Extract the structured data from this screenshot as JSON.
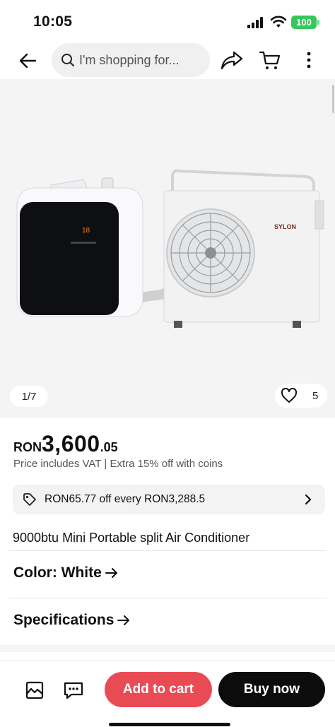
{
  "status": {
    "time": "10:05",
    "battery": "100"
  },
  "nav": {
    "search_placeholder": "I'm shopping for..."
  },
  "gallery": {
    "page": "1/7",
    "likes": "5",
    "brand_label": "SYLON"
  },
  "price": {
    "currency": "RON",
    "main": "3,600",
    "cents": ".05",
    "note": "Price includes VAT | Extra 15% off with coins"
  },
  "coupon": {
    "text": "RON65.77 off every RON3,288.5"
  },
  "product": {
    "title": "9000btu Mini Portable split Air Conditioner"
  },
  "options": {
    "color_label": "Color: White",
    "specifications_label": "Specifications"
  },
  "actions": {
    "add_to_cart": "Add to cart",
    "buy_now": "Buy now"
  },
  "colors": {
    "accent": "#e94b55",
    "battery": "#35c759"
  }
}
